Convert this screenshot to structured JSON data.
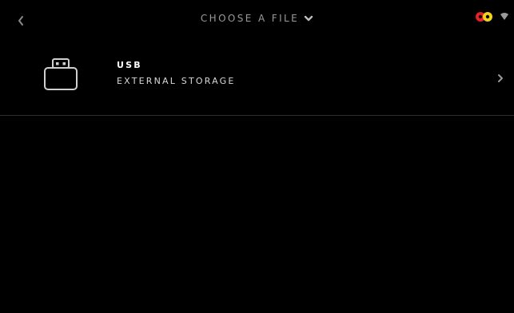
{
  "header": {
    "title": "CHOOSE A FILE",
    "back_icon": "chevron-left-icon",
    "title_dropdown_icon": "chevron-down-icon",
    "status_icons": [
      "link-status-icon",
      "wifi-icon"
    ]
  },
  "files": {
    "items": [
      {
        "title": "USB",
        "subtitle": "EXTERNAL STORAGE",
        "icon": "usb-storage-icon"
      }
    ]
  },
  "colors": {
    "background": "#000000",
    "title_text": "#9a9a9a",
    "primary_text": "#ffffff",
    "divider": "#2e2e2e",
    "status_red": "#e8202a",
    "status_yellow": "#f2d21a"
  }
}
